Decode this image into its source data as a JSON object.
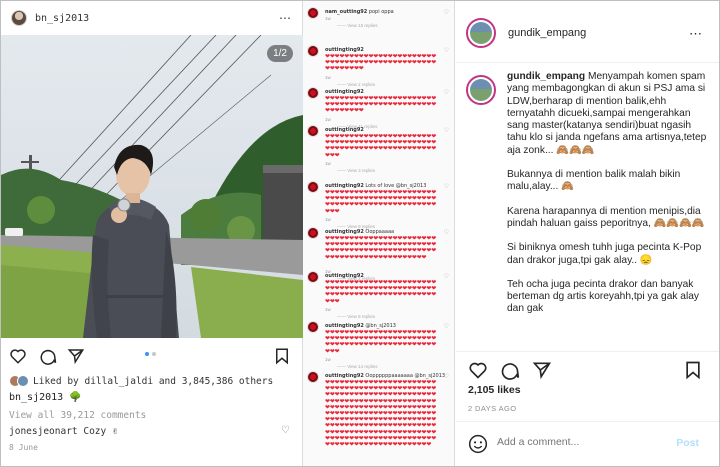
{
  "left_post": {
    "username": "bn_sj2013",
    "photo_counter": "1/2",
    "liked_by": "Liked by dillal_jaldi and 3,845,386 others",
    "caption": "bn_sj2013 🌳",
    "view_all": "View all 39,212 comments",
    "top_comment": "jonesjeonart Cozy ✌",
    "date": "8 June"
  },
  "comment_screenshot": {
    "comments": [
      {
        "name": "nam_outting92",
        "text": "popi oppa",
        "meta": "1w",
        "replies": "View 15 replies"
      },
      {
        "name": "outtingting92",
        "text": "",
        "meta": "1w",
        "replies": "View 2 replies"
      },
      {
        "name": "outtingting92",
        "text": "",
        "meta": "1w",
        "replies": "View 11 replies"
      },
      {
        "name": "outtingting92",
        "text": "",
        "meta": "1w",
        "replies": "View 3 replies"
      },
      {
        "name": "outtingting92",
        "text": "Lots of love @bn_sj2013",
        "meta": "1w",
        "replies": "View 9 replies"
      },
      {
        "name": "outtingting92",
        "text": "Ooppaaaaa",
        "meta": "1w",
        "replies": "View 2 replies"
      },
      {
        "name": "outtingting92",
        "text": "",
        "meta": "1w",
        "replies": "View 8 replies"
      },
      {
        "name": "outtingting92",
        "text": "@bn_sj2013",
        "meta": "1w",
        "replies": "View 14 replies"
      },
      {
        "name": "outtingting92",
        "text": "Ooppppppaaaaaaa @bn_sj2013",
        "meta": "1w",
        "replies": ""
      }
    ]
  },
  "right_panel": {
    "username": "gundik_empang",
    "caption_para1": "Menyampah komen spam yang membagongkan di akun si PSJ ama si LDW,berharap di mention balik,ehh ternyatahh dicueki,sampai mengerahkan sang master(katanya sendiri)buat ngasih tahu klo si janda ngefans ama artisnya,tetep aja zonk... 🙈🙈🙈",
    "caption_para2": "Bukannya di mention balik malah bikin malu,alay... 🙈",
    "caption_para3": "Karena harapannya di mention menipis,dia pindah haluan gaiss peporitnya, 🙈🙈🙈🙈",
    "caption_para4": "Si biniknya omesh tuhh juga pecinta K-Pop dan drakor juga,tpi gak alay.. 😞",
    "caption_para5": "Teh ocha juga pecinta drakor dan banyak berteman dg artis koreyahh,tpi ya gak alay dan gak",
    "likes": "2,105 likes",
    "date": "2 DAYS AGO",
    "add_comment_placeholder": "Add a comment...",
    "post_label": "Post"
  },
  "colors": {
    "heart": "#e8283b",
    "post_disabled": "#b2dffc",
    "link_blue": "#3897f0",
    "story_ring": "#c13584"
  }
}
